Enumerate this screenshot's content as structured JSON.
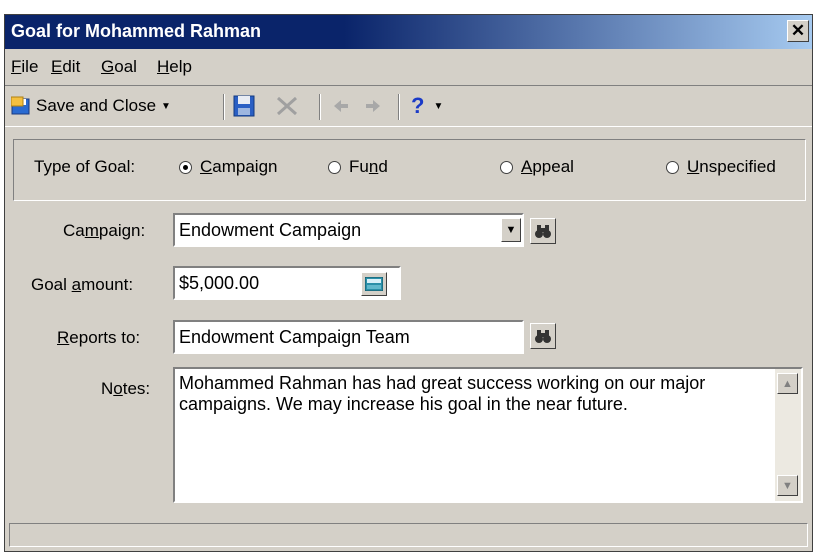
{
  "window": {
    "title": "Goal for Mohammed Rahman"
  },
  "menu": [
    {
      "key": "F",
      "rest": "ile"
    },
    {
      "key": "E",
      "rest": "dit"
    },
    {
      "key": "G",
      "rest": "oal"
    },
    {
      "key": "H",
      "rest": "elp"
    }
  ],
  "toolbar": {
    "save_and_close": "Save and Close",
    "help_glyph": "?"
  },
  "goal_type": {
    "label": "Type of Goal:",
    "options": [
      {
        "key": "C",
        "rest": "ampaign",
        "selected": true
      },
      {
        "pre": "Fu",
        "key": "n",
        "rest": "d",
        "selected": false
      },
      {
        "key": "A",
        "rest": "ppeal",
        "selected": false
      },
      {
        "key": "U",
        "rest": "nspecified",
        "selected": false
      }
    ]
  },
  "form": {
    "campaign": {
      "pre": "Ca",
      "key": "m",
      "rest": "paign:",
      "value": "Endowment Campaign"
    },
    "goal_amount": {
      "pre": "Goal ",
      "key": "a",
      "rest": "mount:",
      "value": "$5,000.00"
    },
    "reports_to": {
      "key": "R",
      "rest": "eports to:",
      "value": "Endowment Campaign Team"
    },
    "notes": {
      "pre": "N",
      "key": "o",
      "rest": "tes:",
      "value": "Mohammed Rahman has had great success working on our major campaigns. We may increase his goal in the near future."
    }
  },
  "colors": {
    "title_bar": "#0a246a",
    "face": "#d4d0c8"
  }
}
